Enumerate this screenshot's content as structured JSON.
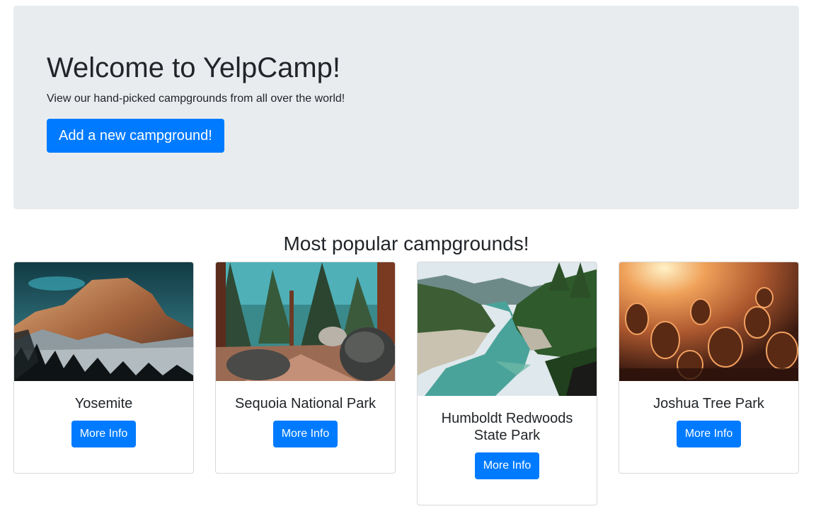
{
  "jumbotron": {
    "title": "Welcome to YelpCamp!",
    "subtitle": "View our hand-picked campgrounds from all over the world!",
    "add_button_label": "Add a new campground!"
  },
  "section": {
    "heading": "Most popular campgrounds!"
  },
  "campgrounds": [
    {
      "name": "Yosemite",
      "button_label": "More Info",
      "image": "half-dome-mountain-photo"
    },
    {
      "name": "Sequoia National Park",
      "button_label": "More Info",
      "image": "sequoia-forest-photo"
    },
    {
      "name": "Humboldt Redwoods State Park",
      "button_label": "More Info",
      "image": "river-redwoods-photo"
    },
    {
      "name": "Joshua Tree Park",
      "button_label": "More Info",
      "image": "cholla-cactus-sunset-photo"
    }
  ],
  "colors": {
    "primary": "#007bff",
    "jumbotron_bg": "#e9ecef",
    "text": "#212529"
  }
}
